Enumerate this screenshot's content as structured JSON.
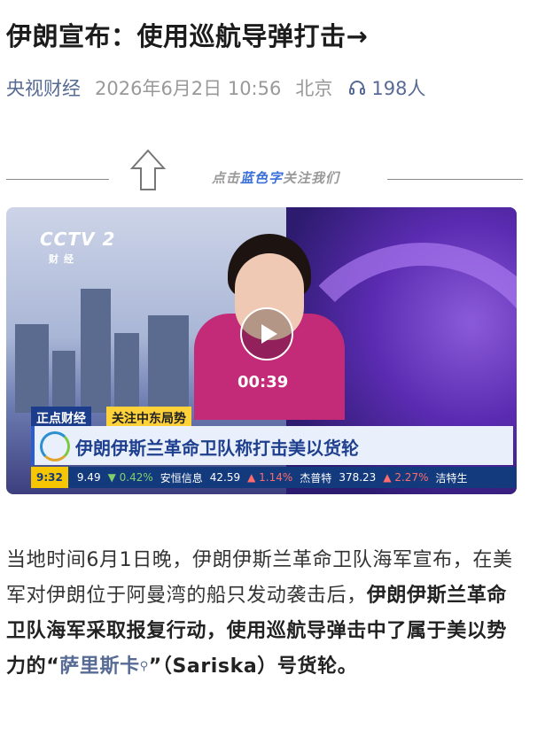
{
  "article": {
    "title": "伊朗宣布：使用巡航导弹打击→",
    "source": "央视财经",
    "date": "2026年6月2日 10:56",
    "location": "北京",
    "listeners": "198人",
    "follow_prompt_pre": "点击",
    "follow_prompt_blue": "蓝色字",
    "follow_prompt_post": "关注我们"
  },
  "video": {
    "duration": "00:39",
    "channel_logo": "CCTV 2",
    "channel_sub": "财经",
    "program_tag": "正点财经",
    "topic_tag": "关注中东局势",
    "headline": "伊朗伊斯兰革命卫队称打击美以货轮",
    "ticker_time": "9:32",
    "ticker_items": [
      "9.49",
      "▼ 0.42%",
      "安恒信息",
      "42.59",
      "▲ 1.14%",
      "杰普特",
      "378.23",
      "▲ 2.27%",
      "洁特生"
    ]
  },
  "body": {
    "p1": "当地时间6月1日晚，伊朗伊斯兰革命卫队海军宣布，在美军对伊朗位于阿曼湾的船只发动袭击后，",
    "p1_bold": "伊朗伊斯兰革命卫队海军采取报复行动，使用巡航导弹击中了属于美以势力的“",
    "p1_link": "萨里斯卡",
    "p1_bold_end": "”（Sariska）号货轮。"
  },
  "colors": {
    "link": "#576b95",
    "banner_blue": "#1b3d8c",
    "tag_yellow": "#ffd23a"
  },
  "icons": {
    "listen": "headphones-icon",
    "follow": "up-arrow-icon",
    "play": "play-icon",
    "search": "search-icon"
  }
}
